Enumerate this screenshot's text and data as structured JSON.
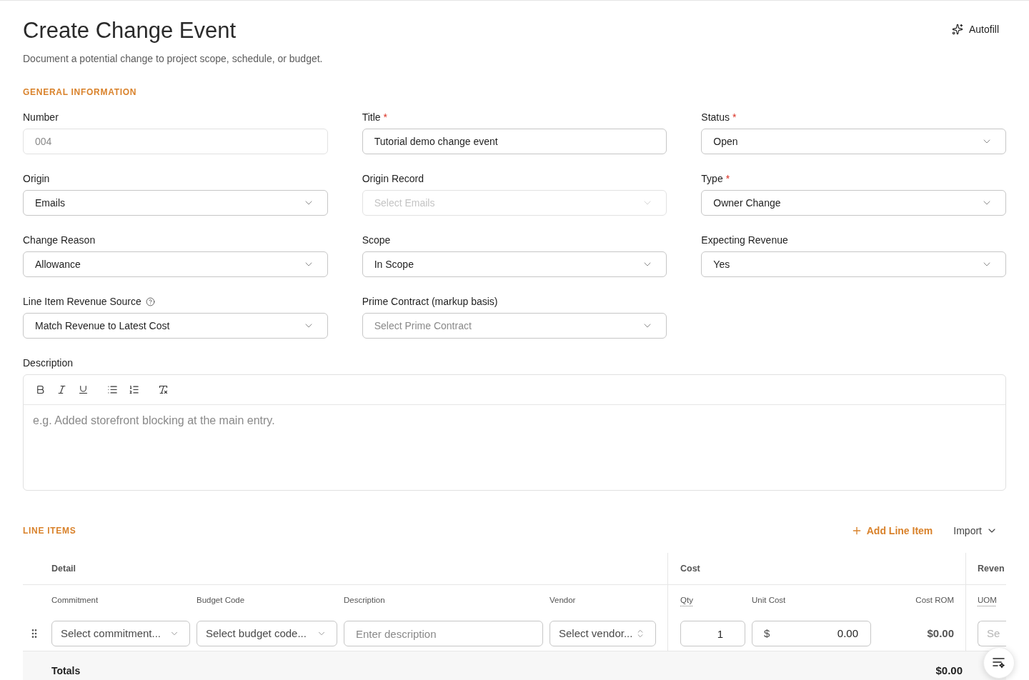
{
  "header": {
    "title": "Create Change Event",
    "subtitle": "Document a potential change to project scope, schedule, or budget.",
    "autofill_button": "Autofill"
  },
  "general_information": {
    "heading": "GENERAL INFORMATION",
    "fields": [
      {
        "label": "Number",
        "kind": "text",
        "placeholder": "004",
        "disabled": true
      },
      {
        "label": "Title",
        "required_mark": "*",
        "kind": "text",
        "value": "Tutorial demo change event",
        "disabled": false
      },
      {
        "label": "Status",
        "required_mark": "*",
        "kind": "select",
        "value": "Open",
        "disabled": false
      },
      {
        "label": "Origin",
        "kind": "select",
        "value": "Emails",
        "disabled": false
      },
      {
        "label": "Origin Record",
        "kind": "select",
        "placeholder": "Select Emails",
        "disabled": true
      },
      {
        "label": "Type",
        "required_mark": "*",
        "kind": "select",
        "value": "Owner Change",
        "disabled": false
      },
      {
        "label": "Change Reason",
        "kind": "select",
        "value": "Allowance",
        "disabled": false
      },
      {
        "label": "Scope",
        "kind": "select",
        "value": "In Scope",
        "disabled": false
      },
      {
        "label": "Expecting Revenue",
        "kind": "select",
        "value": "Yes",
        "disabled": false
      },
      {
        "label": "Line Item Revenue Source",
        "help": true,
        "kind": "select",
        "value": "Match Revenue to Latest Cost",
        "disabled": false
      },
      {
        "label": "Prime Contract (markup basis)",
        "kind": "select",
        "placeholder": "Select Prime Contract",
        "disabled": false
      }
    ]
  },
  "description": {
    "label": "Description",
    "placeholder": "e.g. Added storefront blocking at the main entry."
  },
  "line_items": {
    "heading": "LINE ITEMS",
    "add_button": "Add Line Item",
    "import_button": "Import",
    "groups": [
      {
        "label": "Detail",
        "columns": [
          {
            "label": "Commitment",
            "tooltip": false
          },
          {
            "label": "Budget Code",
            "tooltip": false
          },
          {
            "label": "Description",
            "tooltip": false
          },
          {
            "label": "Vendor",
            "tooltip": false
          }
        ]
      },
      {
        "label": "Cost",
        "columns": [
          {
            "label": "Qty",
            "tooltip": true
          },
          {
            "label": "Unit Cost",
            "tooltip": false
          },
          {
            "label": "Cost ROM",
            "tooltip": false
          }
        ]
      },
      {
        "label": "Reven",
        "columns": [
          {
            "label": "UOM",
            "tooltip": true
          }
        ]
      }
    ],
    "rows": [
      {
        "cells": [
          {
            "kind": "select",
            "placeholder": "Select commitment..."
          },
          {
            "kind": "select",
            "placeholder": "Select budget code..."
          },
          {
            "kind": "text",
            "placeholder": "Enter description"
          },
          {
            "kind": "combobox",
            "placeholder": "Select vendor..."
          },
          {
            "kind": "number",
            "value": "1"
          },
          {
            "kind": "currency",
            "prefix": "$",
            "value": "0.00"
          },
          {
            "kind": "amount",
            "value": "$0.00"
          },
          {
            "kind": "select",
            "placeholder": "Se"
          }
        ]
      }
    ],
    "totals": {
      "label": "Totals",
      "amount": "$0.00"
    }
  }
}
